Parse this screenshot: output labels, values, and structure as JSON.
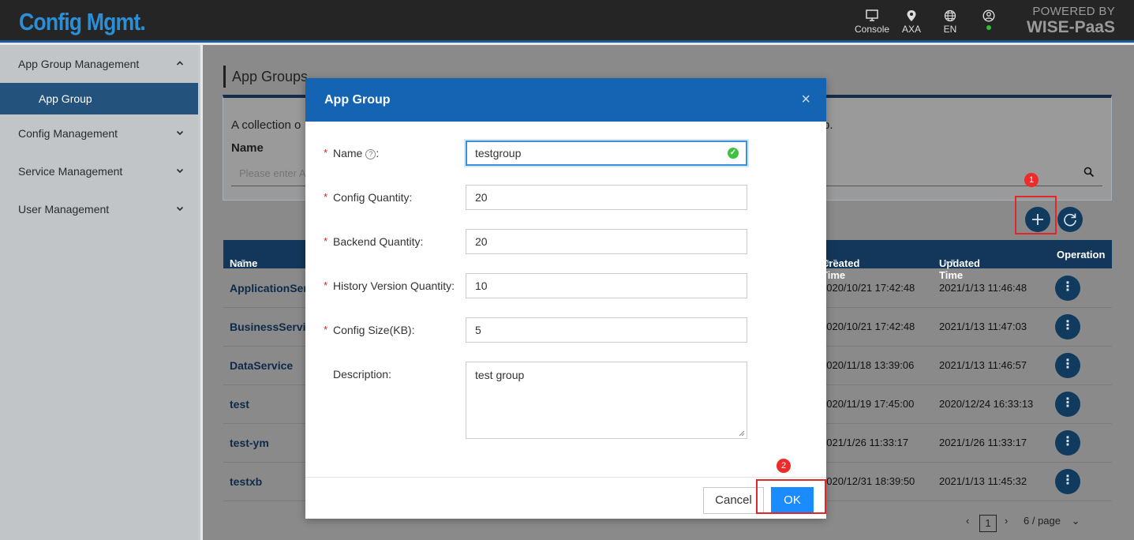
{
  "app": {
    "logo": "Config Mgmt."
  },
  "topbar": {
    "items": [
      {
        "label": "Console",
        "icon": "monitor-icon"
      },
      {
        "label": "AXA",
        "icon": "location-pin-icon"
      },
      {
        "label": "EN",
        "icon": "globe-icon"
      },
      {
        "label": "",
        "icon": "user-icon",
        "status": "online"
      }
    ],
    "powered_line1": "POWERED BY",
    "powered_line2": "WISE-PaaS"
  },
  "sidebar": {
    "items": [
      {
        "label": "App Group Management",
        "expanded": true
      },
      {
        "label": "App Group",
        "active": true
      },
      {
        "label": "Config Management"
      },
      {
        "label": "Service Management"
      },
      {
        "label": "User Management"
      }
    ]
  },
  "main": {
    "title": "App Groups",
    "description_start": "A collection o",
    "description_end": "p.",
    "filter_label": "Name",
    "search_placeholder": "Please enter A",
    "add_icon": "plus-icon",
    "refresh_icon": "refresh-icon"
  },
  "annotations": {
    "step1": "1",
    "step2": "2"
  },
  "table": {
    "headers": {
      "name": "Name",
      "created": "Created Time",
      "updated": "Updated Time",
      "operation": "Operation"
    },
    "rows": [
      {
        "name": "ApplicationSer",
        "created": "2020/10/21 17:42:48",
        "updated": "2021/1/13 11:46:48"
      },
      {
        "name": "BusinessServic",
        "created": "2020/10/21 17:42:48",
        "updated": "2021/1/13 11:47:03"
      },
      {
        "name": "DataService",
        "created": "2020/11/18 13:39:06",
        "updated": "2021/1/13 11:46:57"
      },
      {
        "name": "test",
        "created": "2020/11/19 17:45:00",
        "updated": "2020/12/24 16:33:13"
      },
      {
        "name": "test-ym",
        "created": "2021/1/26 11:33:17",
        "updated": "2021/1/26 11:33:17"
      },
      {
        "name": "testxb",
        "created": "2020/12/31 18:39:50",
        "updated": "2021/1/13 11:45:32"
      }
    ],
    "operation_symbol": "⋮"
  },
  "pagination": {
    "prev": "‹",
    "current": "1",
    "next": "›",
    "page_size": "6 / page"
  },
  "modal": {
    "title": "App Group",
    "close": "×",
    "fields": {
      "name": {
        "label": "Name",
        "suffix": ":",
        "value": "testgroup",
        "help": "?"
      },
      "config_quantity": {
        "label": "Config Quantity:",
        "value": "20"
      },
      "backend_quantity": {
        "label": "Backend Quantity:",
        "value": "20"
      },
      "history_version_quantity": {
        "label": "History Version Quantity:",
        "value": "10"
      },
      "config_size": {
        "label": "Config Size(KB):",
        "value": "5"
      },
      "description": {
        "label": "Description:",
        "value": "test group"
      }
    },
    "required_mark": "*",
    "cancel": "Cancel",
    "ok": "OK"
  }
}
